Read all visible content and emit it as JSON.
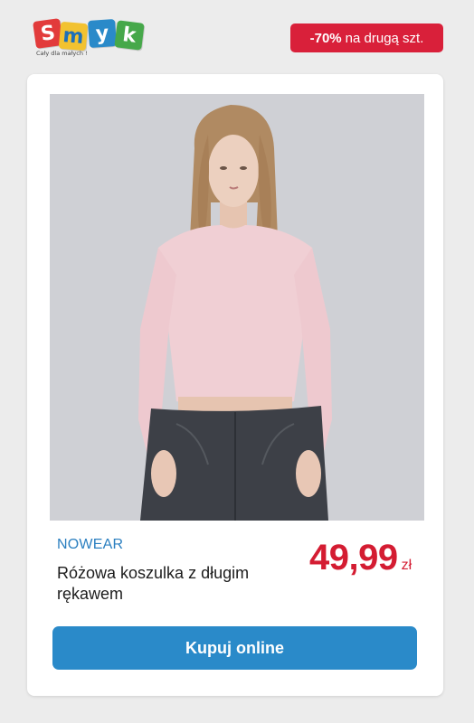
{
  "header": {
    "logo": {
      "letters": [
        {
          "char": "S",
          "bg": "#e23b3b"
        },
        {
          "char": "m",
          "bg": "#f2c230"
        },
        {
          "char": "y",
          "bg": "#2a8ac9"
        },
        {
          "char": "k",
          "bg": "#46a84a"
        }
      ],
      "tagline": "Cały dla małych !"
    },
    "promo": {
      "highlight": "-70%",
      "text": "na drugą szt.",
      "color": "#d9203a"
    }
  },
  "product": {
    "image_icon": "product-photo",
    "brand": "NOWEAR",
    "title": "Różowa koszulka z długim rękawem",
    "price": {
      "amount": "49,99",
      "currency": "zł",
      "color": "#d41c32"
    },
    "buy_button_label": "Kupuj online",
    "buy_button_color": "#2a8ac9"
  }
}
